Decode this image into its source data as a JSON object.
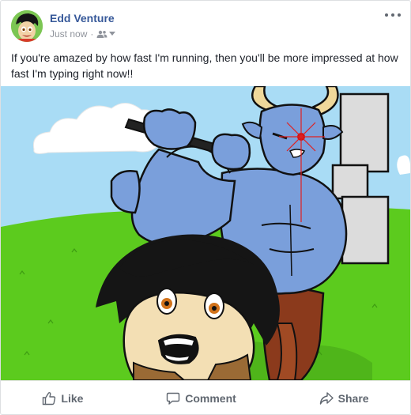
{
  "post": {
    "author": "Edd Venture",
    "timestamp": "Just now",
    "separator": "·",
    "audience_icon": "friends-icon",
    "text": "If you're amazed by how fast I'm running, then you'll be more impressed at how fast I'm typing right now!!"
  },
  "actions": {
    "like": "Like",
    "comment": "Comment",
    "share": "Share"
  },
  "colors": {
    "author_link": "#365899",
    "meta_gray": "#90949c",
    "action_gray": "#606770",
    "sky": "#a8daf6",
    "grass": "#5cc822",
    "monster": "#7d9ed8"
  }
}
